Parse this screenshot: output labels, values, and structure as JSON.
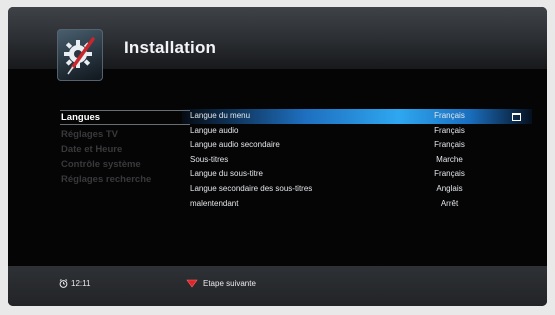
{
  "header": {
    "title": "Installation"
  },
  "sidebar": {
    "items": [
      {
        "label": "Langues"
      },
      {
        "label": "Réglages TV"
      },
      {
        "label": "Date et Heure"
      },
      {
        "label": "Contrôle système"
      },
      {
        "label": "Réglages recherche"
      }
    ],
    "active_index": 0
  },
  "settings": {
    "rows": [
      {
        "label": "Langue du menu",
        "value": "Français"
      },
      {
        "label": "Langue audio",
        "value": "Français"
      },
      {
        "label": "Langue audio secondaire",
        "value": "Français"
      },
      {
        "label": "Sous-titres",
        "value": "Marche"
      },
      {
        "label": "Langue du sous-titre",
        "value": "Français"
      },
      {
        "label": "Langue secondaire des sous-titres",
        "value": "Anglais"
      },
      {
        "label": "malentendant",
        "value": "Arrêt"
      }
    ],
    "selected_index": 0
  },
  "footer": {
    "time": "12:11",
    "next_label": "Etape suivante",
    "next_button_color": "#e0242a"
  },
  "colors": {
    "highlight": "#2fa7f0",
    "background": "#050506"
  },
  "icons": {
    "header": "settings-wrench-icon",
    "footer_clock": "alarm-clock-icon",
    "footer_next": "red-button-icon",
    "row_edit": "keyboard-icon"
  }
}
